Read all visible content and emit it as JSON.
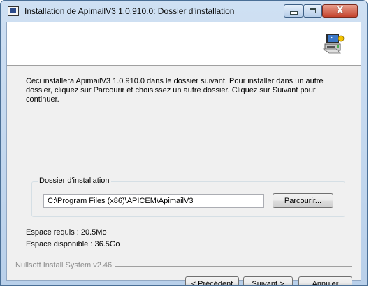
{
  "window": {
    "title": "Installation de ApimailV3 1.0.910.0: Dossier d'installation",
    "minimize_icon": "minimize-icon",
    "maximize_icon": "maximize-icon",
    "close_icon": "close-icon",
    "close_glyph": "X"
  },
  "header": {
    "icon": "installer-computer-icon"
  },
  "content": {
    "description": "Ceci installera ApimailV3 1.0.910.0 dans le dossier suivant. Pour installer dans un autre dossier, cliquez sur Parcourir et choisissez un autre dossier. Cliquez sur Suivant pour continuer.",
    "group_label": "Dossier d'installation",
    "install_path": "C:\\Program Files (x86)\\APICEM\\ApimailV3",
    "browse_label": "Parcourir...",
    "space_required": "Espace requis : 20.5Mo",
    "space_available": "Espace disponible : 36.5Go"
  },
  "footer": {
    "branding": "Nullsoft Install System v2.46",
    "back_label": "< Précédent",
    "next_label": "Suivant >",
    "cancel_label": "Annuler"
  },
  "colors": {
    "titlebar": "#c6dcf2",
    "close_button": "#c4432d",
    "dialog_bg": "#f0f0f0"
  }
}
